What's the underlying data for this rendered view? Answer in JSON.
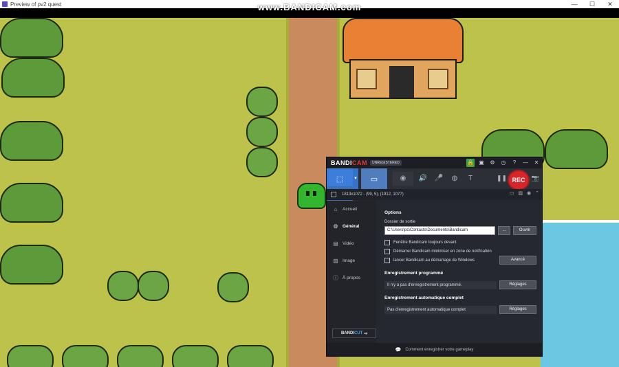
{
  "window": {
    "title": "Preview of pv2 quest",
    "minimize": "—",
    "maximize": "☐",
    "close": "✕"
  },
  "watermark": "www.BANDICAM.com",
  "bandicam": {
    "logo_a": "BANDI",
    "logo_b": "CAM",
    "badge": "UNREGISTERED",
    "header_icons": {
      "lock": "🔒",
      "folder": "▣",
      "settings": "⚙",
      "clock": "◷",
      "help": "?",
      "minimize": "—",
      "close": "✕"
    },
    "toolbar": {
      "rec_label": "REC",
      "modes": [
        {
          "name": "screen-mode",
          "icon": "⬚"
        },
        {
          "name": "hdmi-mode",
          "icon": "▭"
        },
        {
          "name": "game-mode",
          "icon": "🎮"
        }
      ],
      "dropdown": "▼",
      "icons": {
        "webcam": "◉",
        "speaker": "🔊",
        "mic": "🎤",
        "mic2": "◍",
        "text": "T",
        "pause": "❚❚",
        "screenshot": "📷"
      }
    },
    "info": {
      "resolution": "1813x1072 - (99, 5), (1912, 1077)"
    },
    "sidebar": [
      {
        "label": "Accueil",
        "icon": "⌂"
      },
      {
        "label": "Général",
        "icon": "⚙"
      },
      {
        "label": "Vidéo",
        "icon": "▤"
      },
      {
        "label": "Image",
        "icon": "▨"
      },
      {
        "label": "À propos",
        "icon": "ⓘ"
      }
    ],
    "bandicut": {
      "a": "BANDI",
      "b": "CUT",
      "arrow": "⇨"
    },
    "options": {
      "title": "Options",
      "output_label": "Dossier de sortie",
      "output_value": "C:\\Users\\pc\\Contacts\\Documents\\Bandicam",
      "browse": "...",
      "open": "Ouvrir",
      "checks": [
        "Fenêtre Bandicam toujours devant",
        "Démarrer Bandicam minimiser en zone de notification",
        "lancer Bandicam au démarrage de Windows"
      ],
      "advanced": "Avancé"
    },
    "scheduled": {
      "title": "Enregistrement programmé",
      "status": "Il n'y a pas d'enregistrement programmé.",
      "settings": "Réglages"
    },
    "auto": {
      "title": "Enregistrement automatique complet",
      "status": "Pas d'enregistrement automatique complet",
      "settings": "Réglages"
    },
    "footer": {
      "icon": "💬",
      "text": "Comment enregistrer votre gameplay"
    }
  }
}
